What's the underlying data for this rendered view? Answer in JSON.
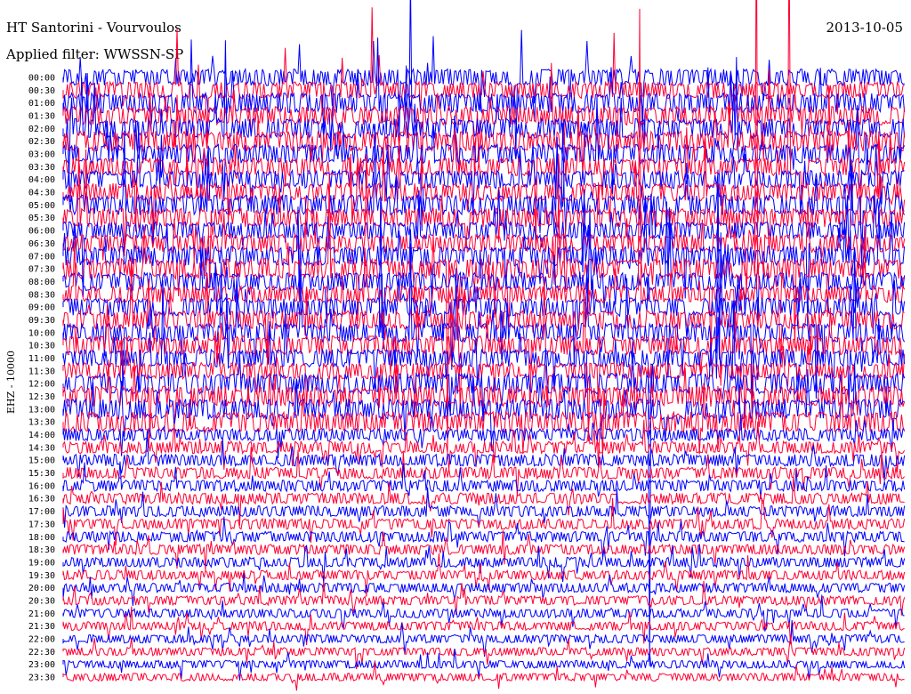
{
  "header": {
    "station": "HT Santorini - Vourvoulos",
    "filter": "Applied filter: WWSSN-SP",
    "date": "2013-10-05"
  },
  "channel_label": "EHZ - 10000",
  "chart_data": {
    "type": "line",
    "title": "HT Santorini - Vourvoulos",
    "subtitle": "Applied filter: WWSSN-SP",
    "date": "2013-10-05",
    "ylabel": "EHZ - 10000",
    "xlabel": "",
    "trace_colors": [
      "#0000ff",
      "#ff0033"
    ],
    "minutes_per_line": 30,
    "grid": false,
    "tick_labels": [
      "00:00",
      "00:30",
      "01:00",
      "01:30",
      "02:00",
      "02:30",
      "03:00",
      "03:30",
      "04:00",
      "04:30",
      "05:00",
      "05:30",
      "06:00",
      "06:30",
      "07:00",
      "07:30",
      "08:00",
      "08:30",
      "09:00",
      "09:30",
      "10:00",
      "10:30",
      "11:00",
      "11:30",
      "12:00",
      "12:30",
      "13:00",
      "13:30",
      "14:00",
      "14:30",
      "15:00",
      "15:30",
      "16:00",
      "16:30",
      "17:00",
      "17:30",
      "18:00",
      "18:30",
      "19:00",
      "19:30",
      "20:00",
      "20:30",
      "21:00",
      "21:30",
      "22:00",
      "22:30",
      "23:00",
      "23:30"
    ]
  }
}
